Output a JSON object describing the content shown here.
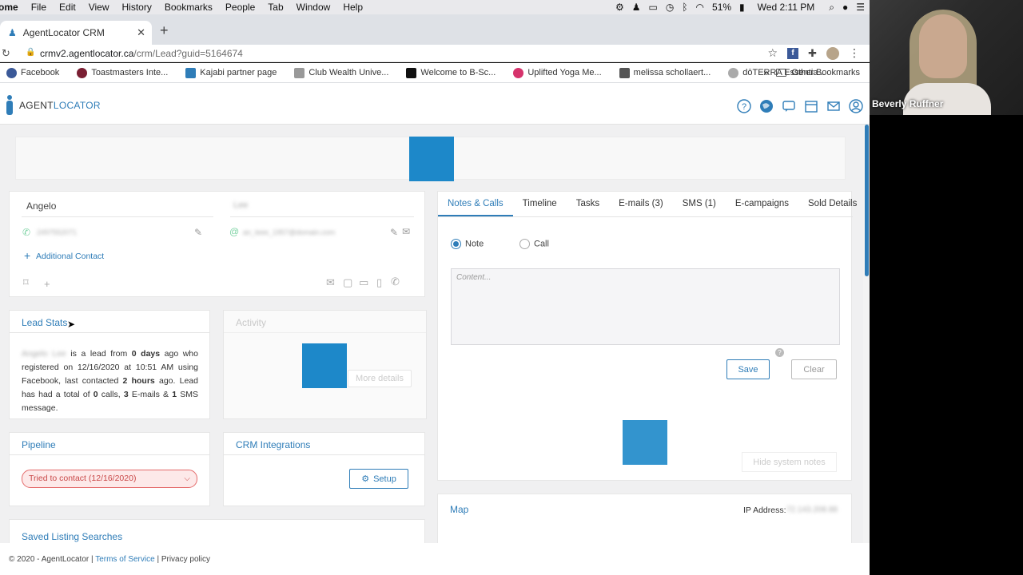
{
  "mac_menu": {
    "app": "ome",
    "items": [
      "File",
      "Edit",
      "View",
      "History",
      "Bookmarks",
      "People",
      "Tab",
      "Window",
      "Help"
    ],
    "battery": "51%",
    "clock": "Wed 2:11 PM"
  },
  "browser": {
    "tab_title": "AgentLocator CRM",
    "url_host": "crmv2.agentlocator.ca",
    "url_path": "/crm/Lead?guid=5164674",
    "bookmarks": [
      "Facebook",
      "Toastmasters Inte...",
      "Kajabi partner page",
      "Club Wealth Unive...",
      "Welcome to B-Sc...",
      "Uplifted Yoga Me...",
      "melissa schollaert...",
      "dōTERRA Essentia..."
    ],
    "other_bookmarks": "Other Bookmarks",
    "overflow": "»"
  },
  "app": {
    "brand_prefix": "AGENT",
    "brand_suffix": "LOCATOR",
    "contact": {
      "first_name": "Angelo",
      "last_name": "Lee",
      "phone": "2497552071",
      "email": "an_leee_1957@domain.com",
      "additional_contact": "Additional Contact"
    },
    "notes": {
      "tabs": [
        "Notes & Calls",
        "Timeline",
        "Tasks",
        "E-mails (3)",
        "SMS (1)",
        "E-campaigns",
        "Sold Details"
      ],
      "radio_note": "Note",
      "radio_call": "Call",
      "content_placeholder": "Content...",
      "save": "Save",
      "clear": "Clear",
      "hide_system_notes": "Hide system notes"
    },
    "lead_stats": {
      "title": "Lead Stats",
      "name": "Angelo Lee",
      "t1": " is a lead from ",
      "days": "0 days",
      "t2": " ago who registered on 12/16/2020 at 10:51 AM using Facebook, last contacted ",
      "hours": "2 hours",
      "t3": " ago. Lead has had a total of ",
      "calls": "0",
      "t4": " calls, ",
      "emails": "3",
      "t5": " E-mails & ",
      "sms": "1",
      "t6": " SMS message."
    },
    "activity": {
      "title": "Activity",
      "more_details": "More details"
    },
    "pipeline": {
      "title": "Pipeline",
      "status": "Tried to contact (12/16/2020)"
    },
    "crm": {
      "title": "CRM Integrations",
      "setup": "Setup"
    },
    "map": {
      "title": "Map",
      "ip_label": "IP Address:",
      "ip_value": "72.143.208.88"
    },
    "saved_searches": {
      "title": "Saved Listing Searches"
    },
    "footer": {
      "copyright": "© 2020 - AgentLocator | ",
      "terms": "Terms of Service",
      "privacy": " | Privacy policy"
    }
  },
  "video": {
    "participant": "Beverly Ruffner"
  },
  "colors": {
    "accent": "#2f7db8",
    "block": "#1d88c9",
    "pipeline_red": "#c94848"
  }
}
